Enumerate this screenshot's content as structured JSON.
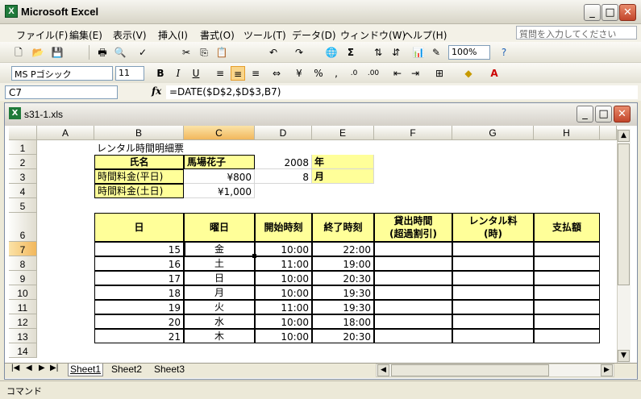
{
  "app": {
    "title": "Microsoft Excel"
  },
  "menu": [
    "ファイル(F)",
    "編集(E)",
    "表示(V)",
    "挿入(I)",
    "書式(O)",
    "ツール(T)",
    "データ(D)",
    "ウィンドウ(W)",
    "ヘルプ(H)"
  ],
  "help_placeholder": "質問を入力してください",
  "toolbar": {
    "zoom": "100%",
    "font": "MS Pゴシック",
    "size": "11"
  },
  "formula_bar": {
    "name_box": "C7",
    "fx": "fx",
    "formula": "=DATE($D$2,$D$3,B7)"
  },
  "workbook": {
    "title": "s31-1.xls"
  },
  "columns": [
    "A",
    "B",
    "C",
    "D",
    "E",
    "F",
    "G",
    "H"
  ],
  "rows": [
    "1",
    "2",
    "3",
    "4",
    "5",
    "6",
    "7",
    "8",
    "9",
    "10",
    "11",
    "12",
    "13",
    "14"
  ],
  "cells": {
    "B1": "レンタル時間明細票",
    "B2": "氏名",
    "C2": "馬場花子",
    "D2": "2008",
    "E2": "年",
    "B3": "時間料金(平日)",
    "C3": "¥800",
    "D3": "8",
    "E3": "月",
    "B4": "時間料金(土日)",
    "C4": "¥1,000",
    "B6": "日",
    "C6": "曜日",
    "D6": "開始時刻",
    "E6": "終了時刻",
    "F6a": "貸出時間",
    "F6b": "(超過割引)",
    "G6a": "レンタル料",
    "G6b": "(時)",
    "H6": "支払額"
  },
  "table": [
    {
      "day": "15",
      "wd": "金",
      "start": "10:00",
      "end": "22:00"
    },
    {
      "day": "16",
      "wd": "土",
      "start": "11:00",
      "end": "19:00"
    },
    {
      "day": "17",
      "wd": "日",
      "start": "10:00",
      "end": "20:30"
    },
    {
      "day": "18",
      "wd": "月",
      "start": "10:00",
      "end": "19:30"
    },
    {
      "day": "19",
      "wd": "火",
      "start": "11:00",
      "end": "19:30"
    },
    {
      "day": "20",
      "wd": "水",
      "start": "10:00",
      "end": "18:00"
    },
    {
      "day": "21",
      "wd": "木",
      "start": "10:00",
      "end": "20:30"
    }
  ],
  "sheets": [
    "Sheet1",
    "Sheet2",
    "Sheet3"
  ],
  "status": "コマンド"
}
